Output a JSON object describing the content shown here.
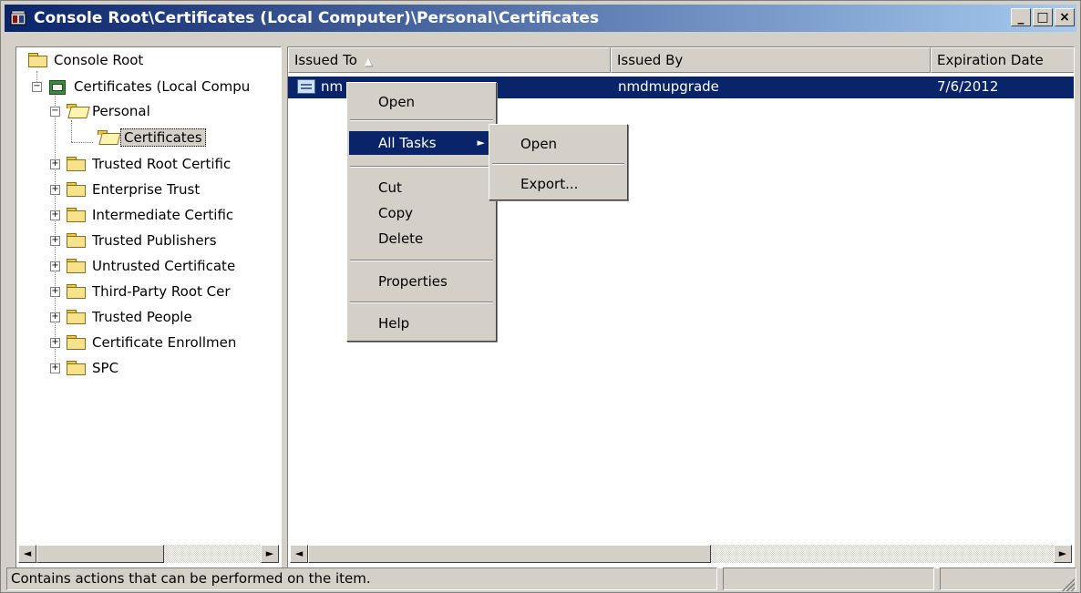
{
  "window": {
    "title": "Console Root\\Certificates (Local Computer)\\Personal\\Certificates",
    "buttons": {
      "minimize": "_",
      "maximize": "□",
      "close": "×"
    }
  },
  "tree": {
    "root": "Console Root",
    "store": "Certificates (Local Compu",
    "items": [
      "Personal",
      "Certificates",
      "Trusted Root Certific",
      "Enterprise Trust",
      "Intermediate Certific",
      "Trusted Publishers",
      "Untrusted Certificate",
      "Third-Party Root Cer",
      "Trusted People",
      "Certificate Enrollmen",
      "SPC"
    ],
    "expander_plus": "+",
    "expander_minus": "−"
  },
  "list": {
    "columns": [
      "Issued To",
      "Issued By",
      "Expiration Date"
    ],
    "sort_indicator": "▲",
    "rows": [
      {
        "issued_to": "nm",
        "issued_by": "nmdmupgrade",
        "expiration": "7/6/2012"
      }
    ]
  },
  "context_menu": {
    "items": [
      "Open",
      "All Tasks",
      "Cut",
      "Copy",
      "Delete",
      "Properties",
      "Help"
    ]
  },
  "submenu": {
    "items": [
      "Open",
      "Export..."
    ]
  },
  "scroll": {
    "left_arrow": "◄",
    "right_arrow": "►",
    "submenu_arrow": "►"
  },
  "status": {
    "message": "Contains actions that can be performed on the item.",
    "panel2": "",
    "panel3": ""
  },
  "colors": {
    "selection": "#0a246a",
    "face": "#d4d0c8"
  }
}
